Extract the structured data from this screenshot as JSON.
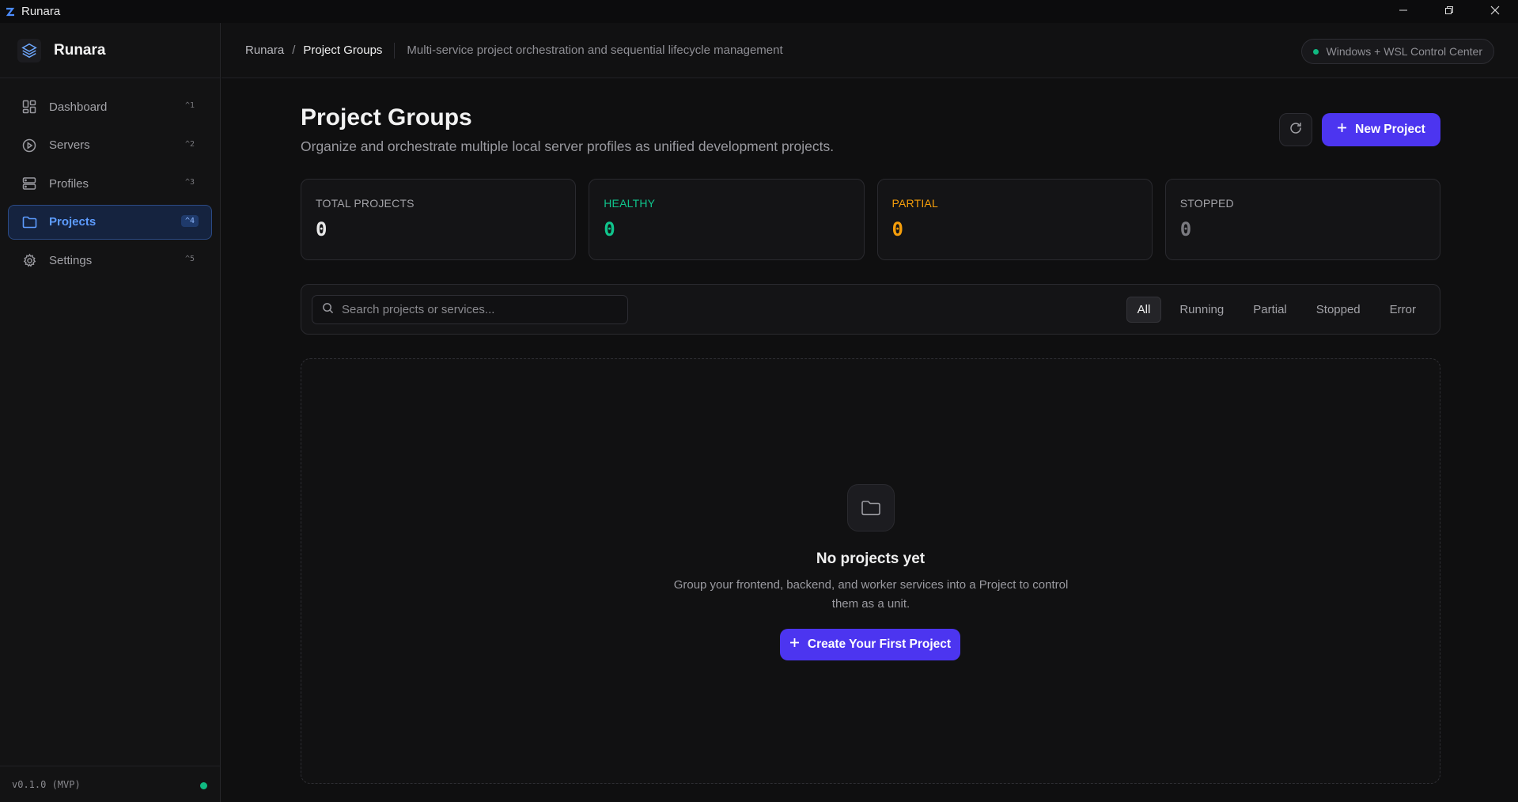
{
  "window": {
    "title": "Runara",
    "controls": [
      "minimize-icon",
      "restore-icon",
      "close-icon"
    ]
  },
  "sidebar": {
    "brand": "Runara",
    "items": [
      {
        "label": "Dashboard",
        "shortcut": "^1",
        "icon": "dashboard-icon"
      },
      {
        "label": "Servers",
        "shortcut": "^2",
        "icon": "play-circle-icon"
      },
      {
        "label": "Profiles",
        "shortcut": "^3",
        "icon": "server-rack-icon"
      },
      {
        "label": "Projects",
        "shortcut": "^4",
        "icon": "folder-icon",
        "active": true
      },
      {
        "label": "Settings",
        "shortcut": "^5",
        "icon": "gear-icon"
      }
    ],
    "version": "v0.1.0 (MVP)"
  },
  "header": {
    "breadcrumb_root": "Runara",
    "breadcrumb_sep": "/",
    "breadcrumb_current": "Project Groups",
    "description": "Multi-service project orchestration and sequential lifecycle management",
    "env_badge": "Windows + WSL Control Center"
  },
  "page": {
    "title": "Project Groups",
    "subtitle": "Organize and orchestrate multiple local server profiles as unified development projects.",
    "new_button": "New Project"
  },
  "stats": [
    {
      "label": "TOTAL PROJECTS",
      "value": "0"
    },
    {
      "label": "HEALTHY",
      "value": "0"
    },
    {
      "label": "PARTIAL",
      "value": "0"
    },
    {
      "label": "STOPPED",
      "value": "0"
    }
  ],
  "filters": {
    "search_placeholder": "Search projects or services...",
    "tabs": [
      "All",
      "Running",
      "Partial",
      "Stopped",
      "Error"
    ],
    "active_tab": "All"
  },
  "empty_state": {
    "title": "No projects yet",
    "description": "Group your frontend, backend, and worker services into a Project to control them as a unit.",
    "button": "Create Your First Project"
  },
  "colors": {
    "accent": "#4c35f0",
    "active_nav": "#5d9cff",
    "healthy": "#10c48c",
    "partial": "#f59e0b",
    "status_ok": "#10b981"
  }
}
